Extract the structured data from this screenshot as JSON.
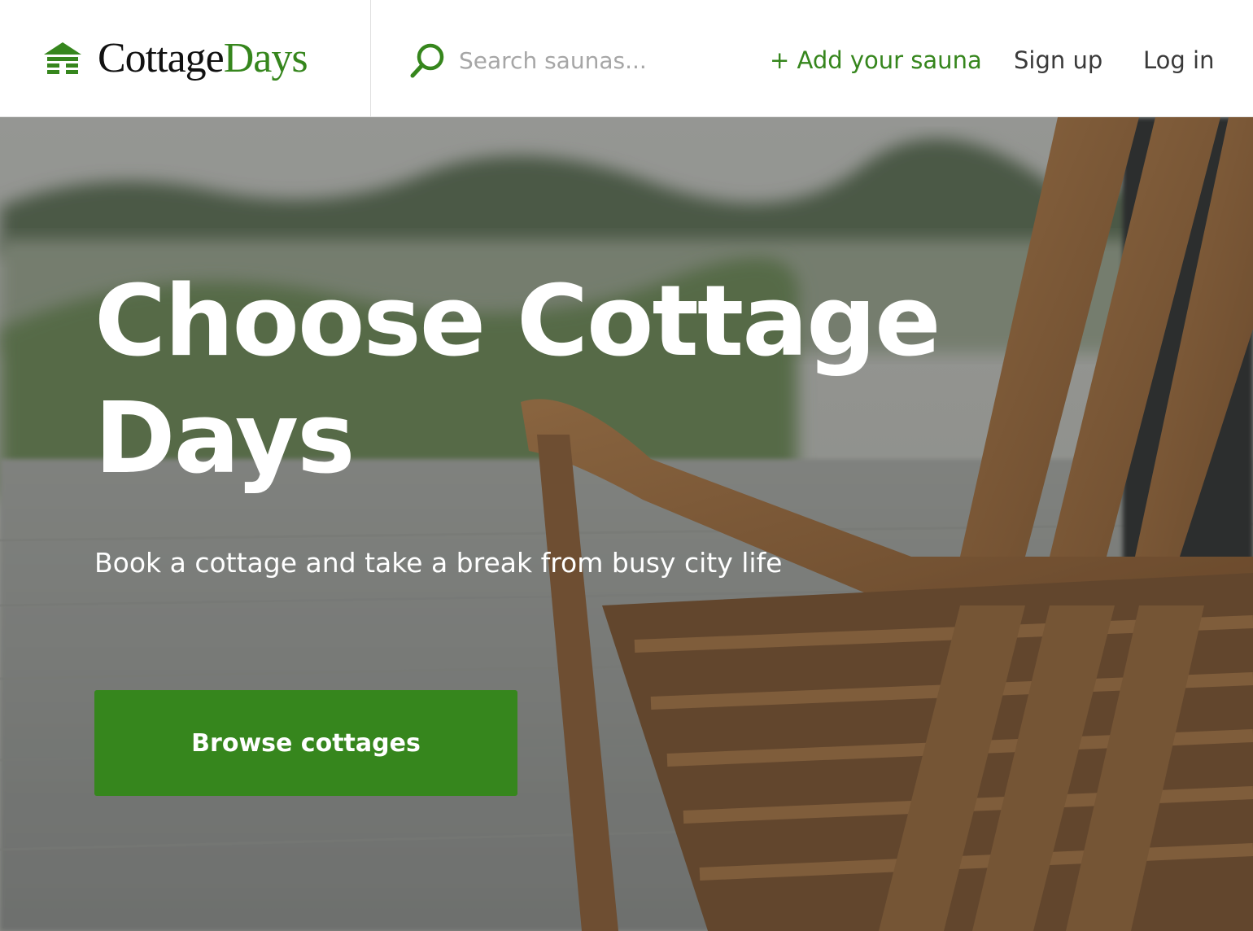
{
  "brand": {
    "name_part1": "Cottage",
    "name_part2": "Days",
    "logo_icon": "cabin-icon",
    "accent_color": "#36861d"
  },
  "search": {
    "icon": "search-icon",
    "placeholder": "Search saunas..."
  },
  "nav": {
    "add_label": "+ Add your sauna",
    "signup_label": "Sign up",
    "login_label": "Log in"
  },
  "hero": {
    "title": "Choose Cottage Days",
    "subtitle": "Book a cottage and take a break from busy city life",
    "cta_label": "Browse cottages",
    "cta_color": "#36861d"
  }
}
